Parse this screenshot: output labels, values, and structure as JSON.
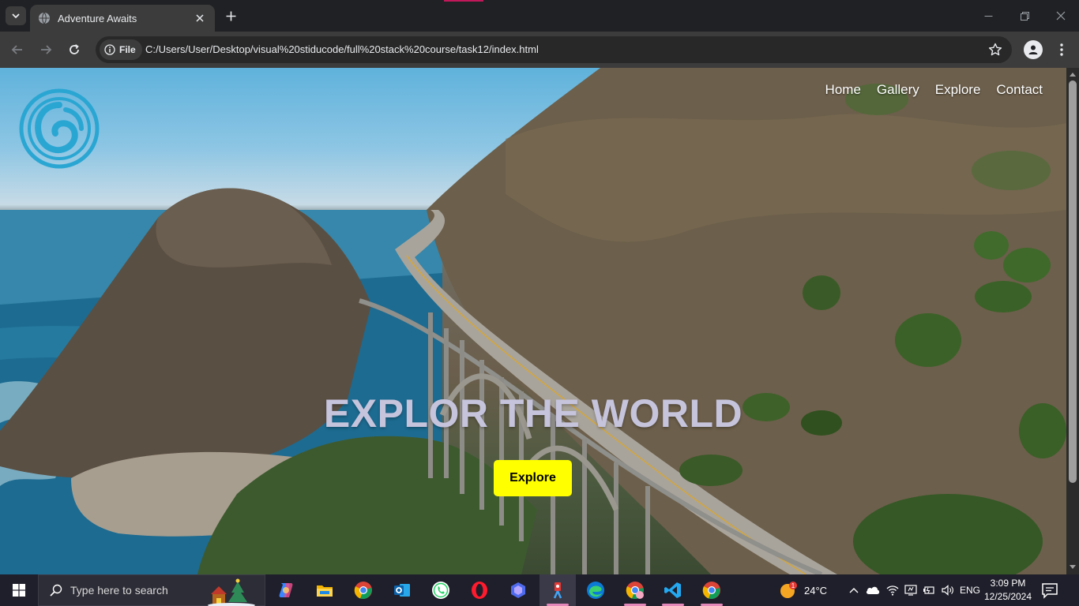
{
  "browser": {
    "tab_title": "Adventure Awaits",
    "site_chip_label": "File",
    "url": "C:/Users/User/Desktop/visual%20stiducode/full%20stack%20course/task12/index.html"
  },
  "page": {
    "nav": [
      "Home",
      "Gallery",
      "Explore",
      "Contact"
    ],
    "hero_title": "EXPLOR THE WORLD",
    "hero_button": "Explore",
    "colors": {
      "hero_button_bg": "#ffff00",
      "hero_title": "#c6c4dd",
      "logo": "#2aa6d3"
    }
  },
  "taskbar": {
    "search_placeholder": "Type here to search",
    "apps": [
      "copilot-icon",
      "file-explorer-icon",
      "chrome-icon",
      "outlook-icon",
      "whatsapp-icon",
      "opera-icon",
      "bing-icon",
      "app-icon",
      "edge-icon",
      "chrome-profile-icon",
      "vscode-icon",
      "chrome-icon"
    ],
    "weather_temp": "24°C",
    "weather_badge": "1",
    "language": "ENG",
    "time": "3:09 PM",
    "date": "12/25/2024"
  }
}
